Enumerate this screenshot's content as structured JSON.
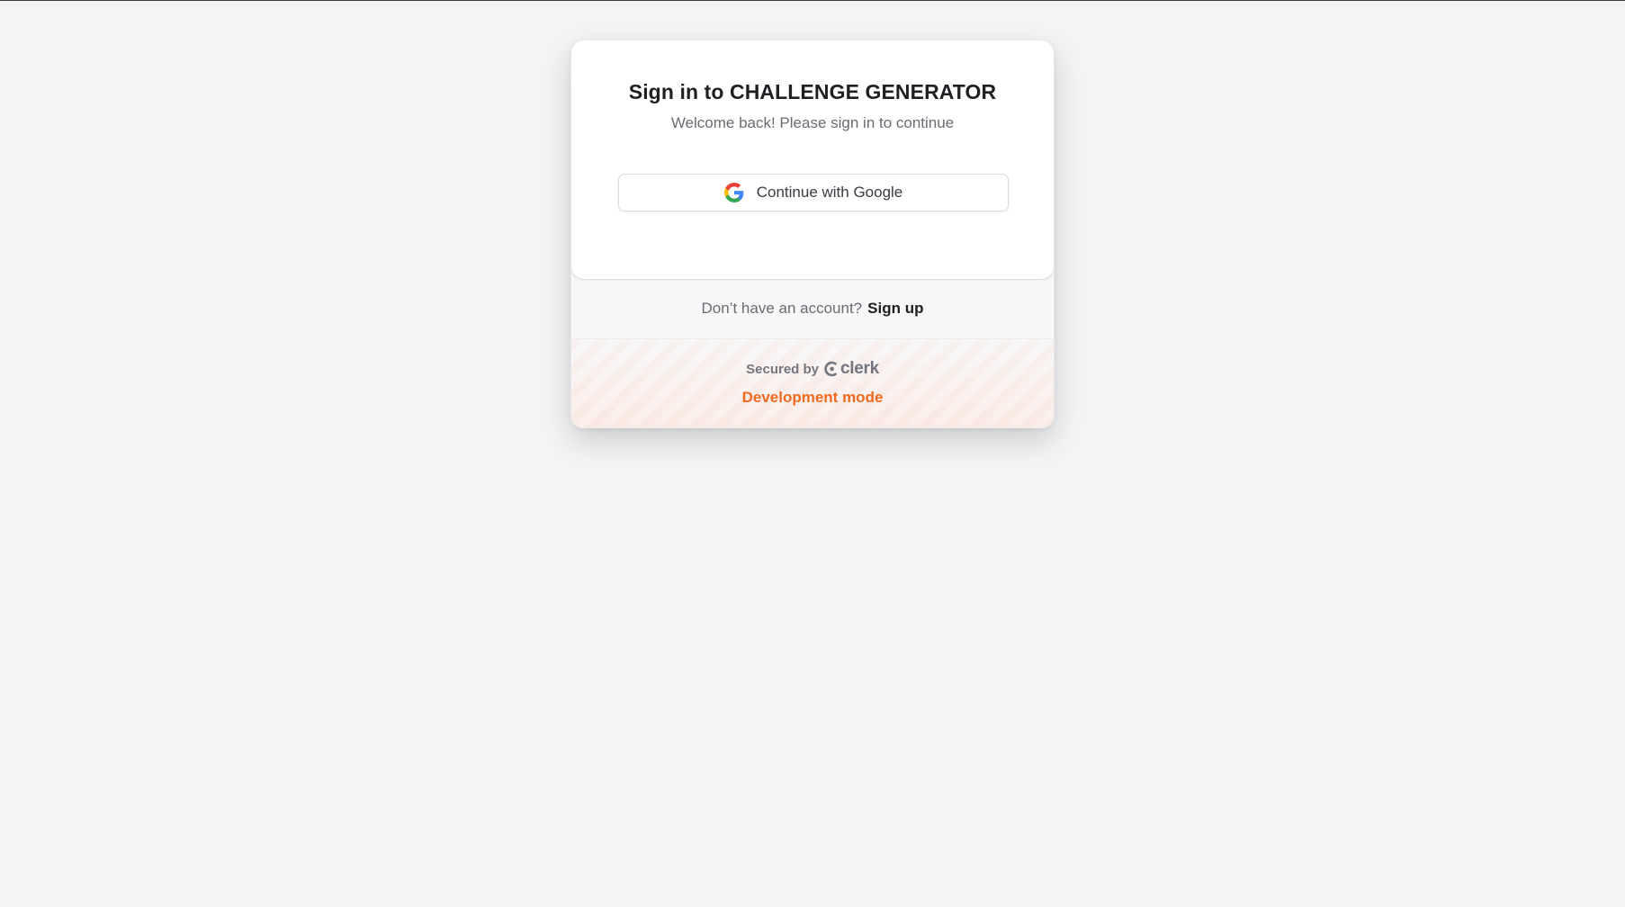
{
  "signin": {
    "title": "Sign in to CHALLENGE GENERATOR",
    "subtitle": "Welcome back! Please sign in to continue",
    "google_button_label": "Continue with Google",
    "signup_prompt": "Don’t have an account?",
    "signup_link": "Sign up",
    "secured_by": "Secured by",
    "provider_name": "clerk",
    "dev_mode": "Development mode"
  },
  "colors": {
    "background": "#f3f4f6",
    "accent_dev": "#ef6a22",
    "google_blue": "#4285F4",
    "google_red": "#EA4335",
    "google_yellow": "#FBBC05",
    "google_green": "#34A853"
  },
  "icons": {
    "google": "google-icon",
    "clerk": "clerk-icon"
  }
}
